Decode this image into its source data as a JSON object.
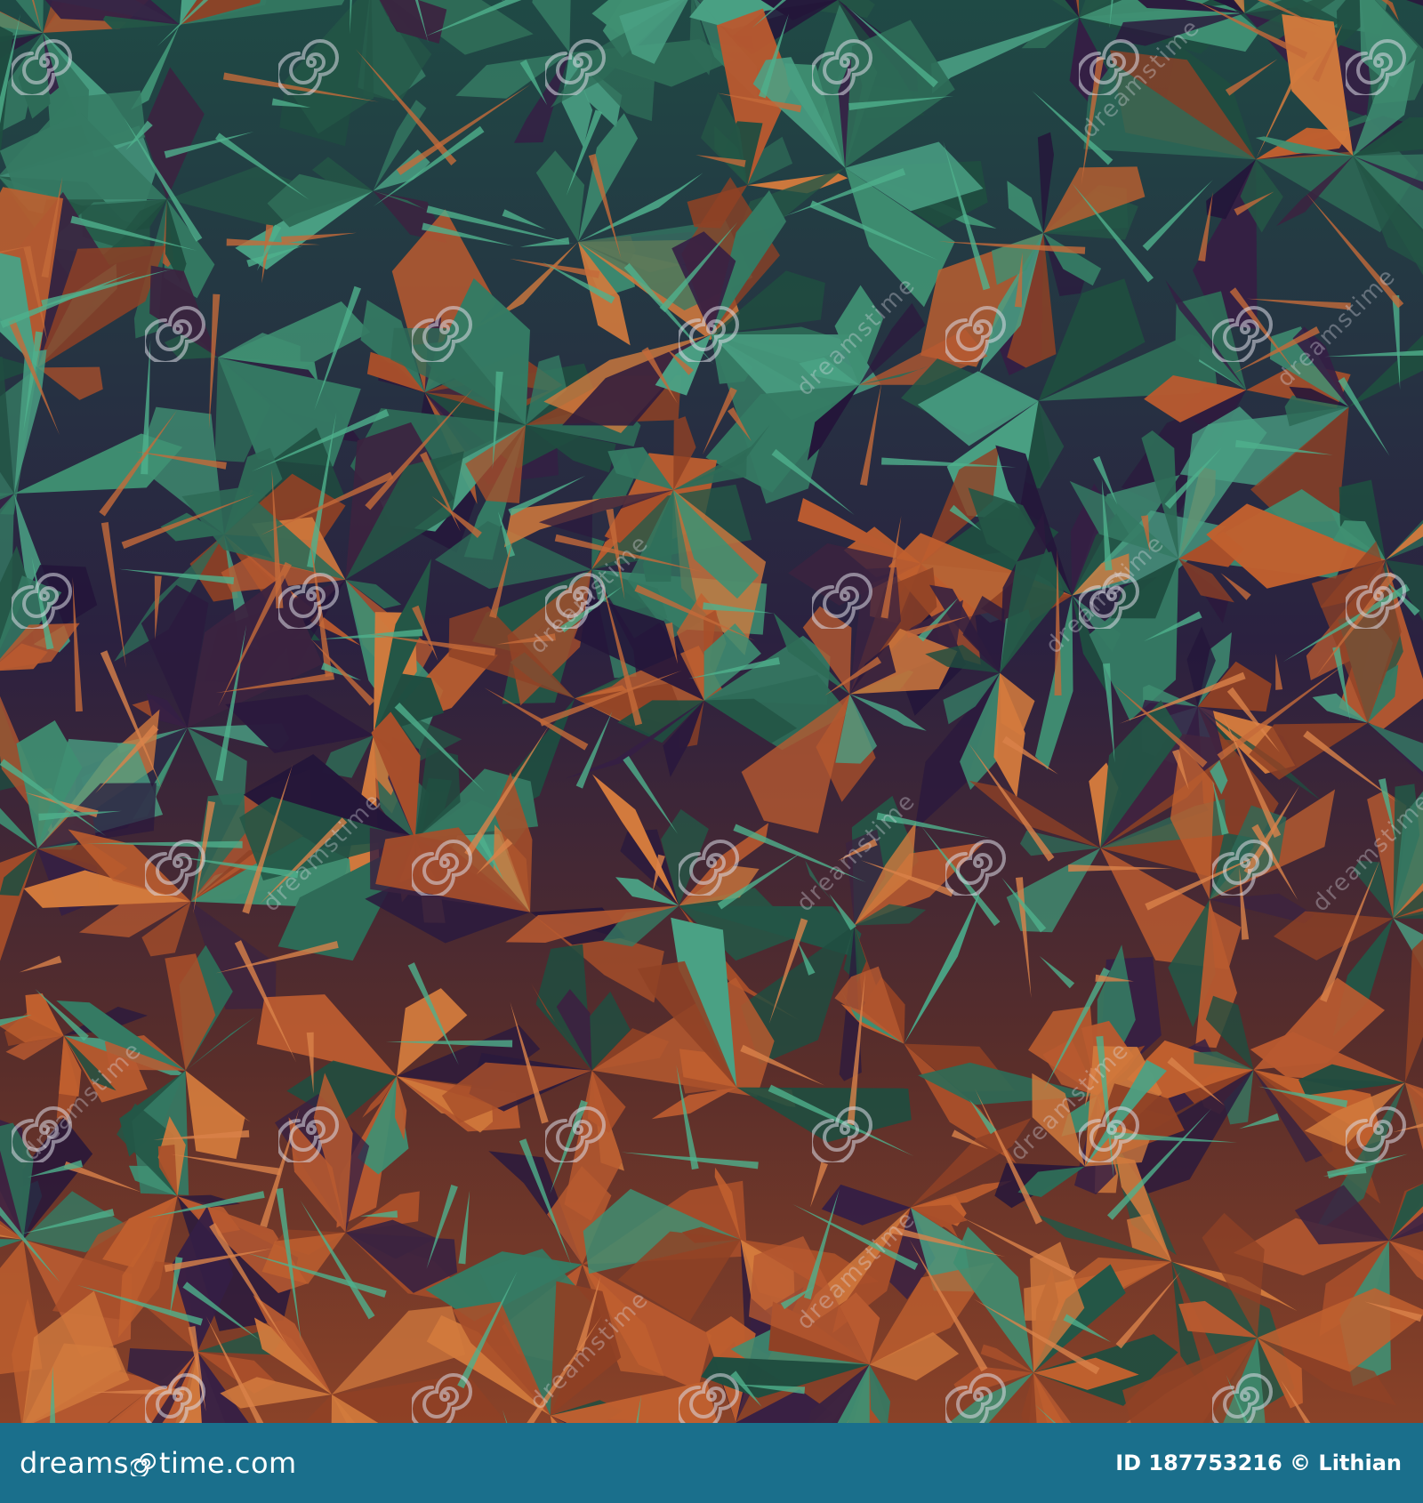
{
  "image": {
    "subject": "abstract low-poly crystalline triangle shards",
    "palette": {
      "teal": "#2e6b57",
      "teal_light": "#3f8f72",
      "orange": "#c0602f",
      "orange_dark": "#7a3222",
      "plum": "#2b1a3d"
    }
  },
  "watermark": {
    "text": "dreamstime",
    "icon": "spiral-icon"
  },
  "footer": {
    "logo_prefix": "dreams",
    "logo_suffix": "time.com",
    "credit": "ID 187753216 © Lithian",
    "background": "#1a6f8c"
  }
}
